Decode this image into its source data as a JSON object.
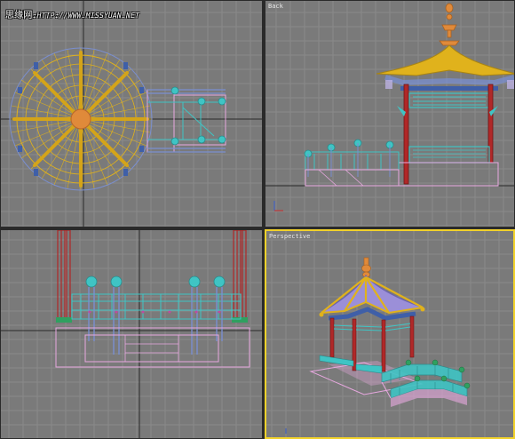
{
  "watermark": {
    "site_name": "思缘网",
    "url": ":HTTP://WWW.MISSYUAN.NET"
  },
  "viewports": {
    "top": {
      "label": ""
    },
    "back": {
      "label": "Back"
    },
    "left": {
      "label": ""
    },
    "perspective": {
      "label": "Perspective",
      "active": true
    }
  },
  "colors": {
    "viewport_bg": "#7a7a7a",
    "grid_line": "#8a8a8a",
    "axis_line": "#2a2a2a",
    "active_border": "#f2d22b",
    "roof_yellow": "#e0b21c",
    "wire_blue": "#7a8fd0",
    "column_red": "#b02828",
    "rail_cyan": "#3fc4c4",
    "base_pink": "#e8a8e0",
    "finial_orange": "#e08a3a"
  }
}
